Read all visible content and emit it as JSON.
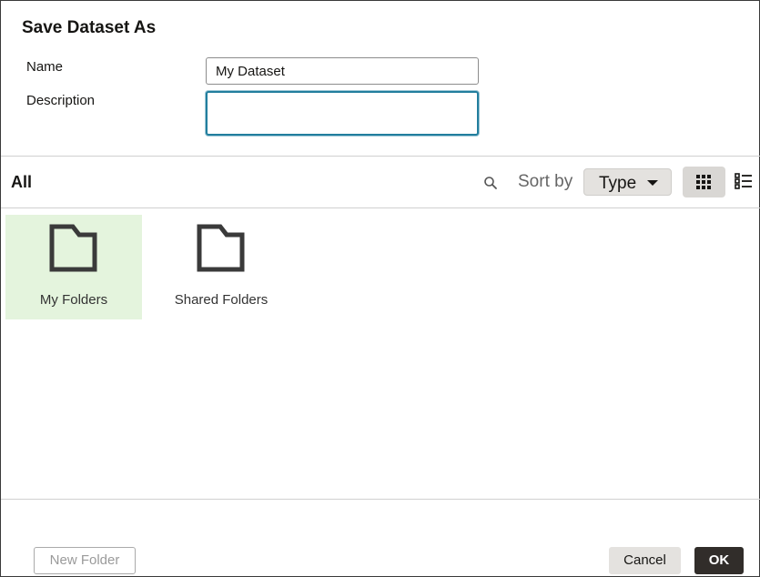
{
  "dialog": {
    "title": "Save Dataset As",
    "name_label": "Name",
    "name_value": "My Dataset",
    "description_label": "Description",
    "description_value": ""
  },
  "browser": {
    "scope_label": "All",
    "search_icon": "search-icon",
    "sort_label": "Sort by",
    "sort_value": "Type",
    "view_modes": [
      "grid-view-icon",
      "list-view-icon"
    ],
    "active_view": "grid",
    "folders": [
      {
        "label": "My Folders",
        "icon": "folder-icon",
        "selected": true
      },
      {
        "label": "Shared Folders",
        "icon": "folder-icon",
        "selected": false
      }
    ]
  },
  "footer": {
    "new_folder_label": "New Folder",
    "cancel_label": "Cancel",
    "ok_label": "OK"
  },
  "colors": {
    "selected_tile": "#e4f4dd",
    "focus_border": "#227e9e",
    "primary_button": "#312d2a"
  }
}
